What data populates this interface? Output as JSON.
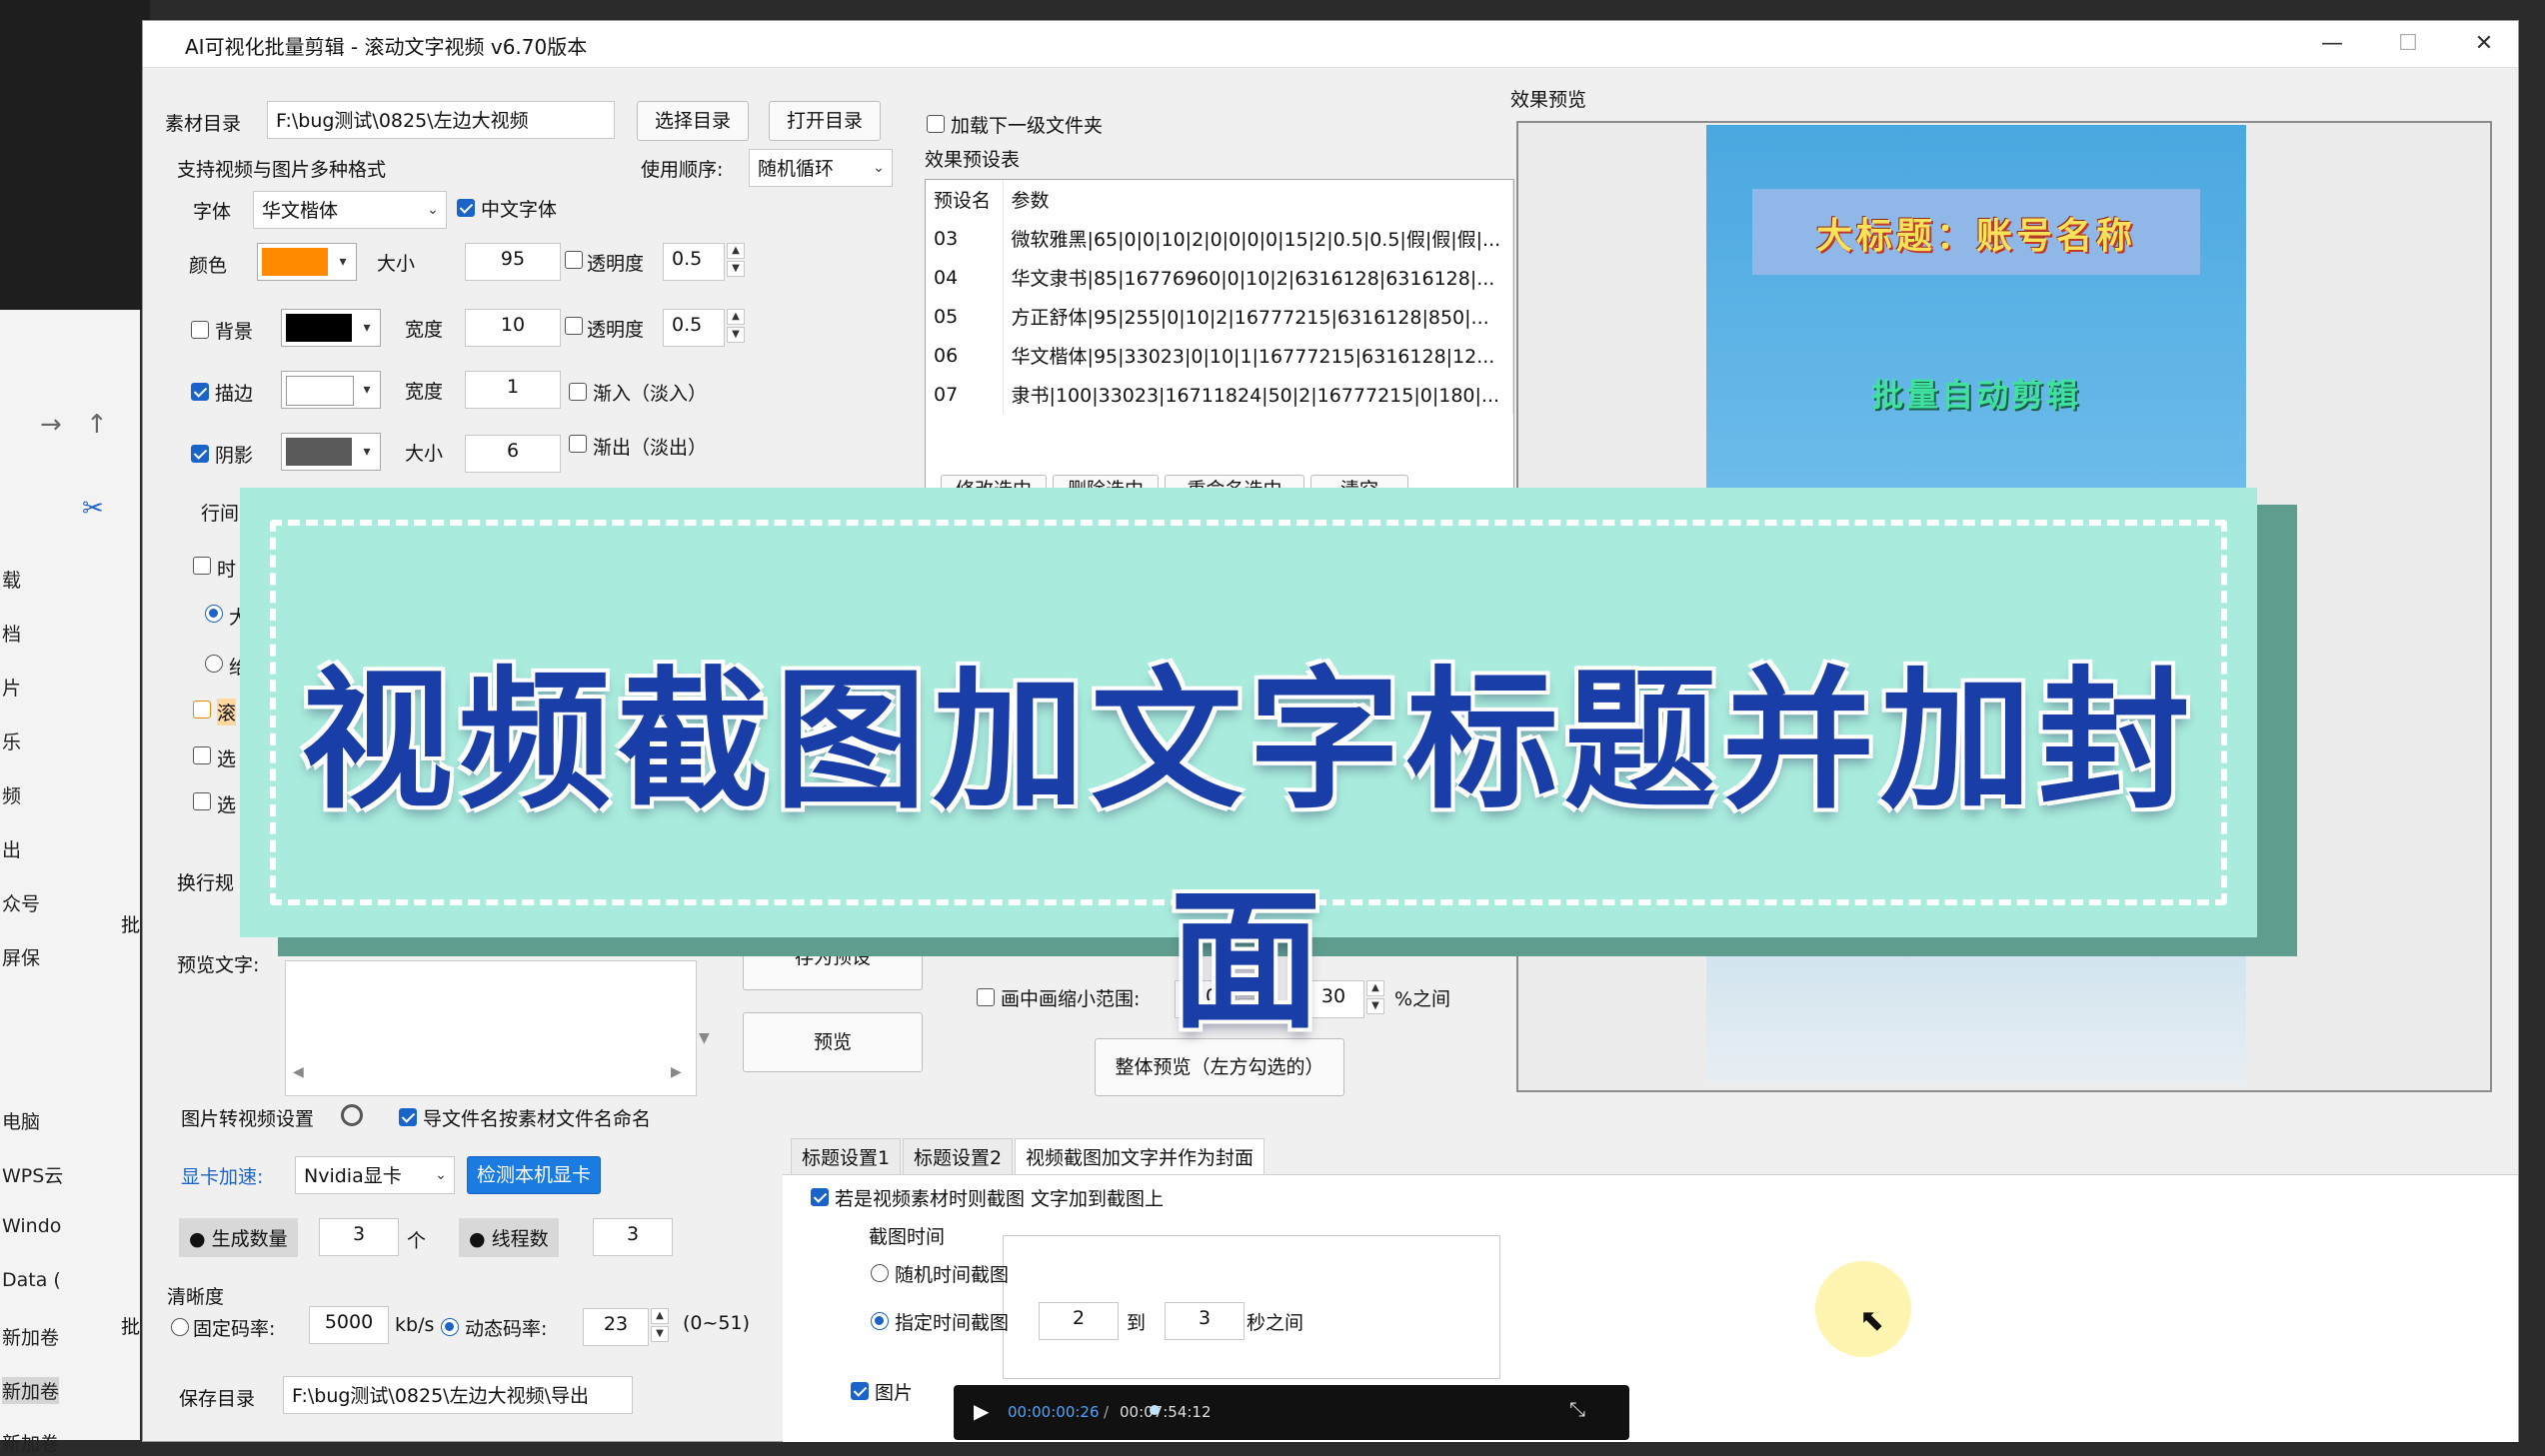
{
  "window": {
    "title": "AI可视化批量剪辑 - 滚动文字视频  v6.70版本",
    "min_icon": "—",
    "max_icon": "☐",
    "close_icon": "✕"
  },
  "explorer": {
    "items": [
      "载",
      "档",
      "片",
      "乐",
      "频",
      "出",
      "众号",
      "屏保",
      "电脑",
      "WPS云",
      "Windo",
      "Data (",
      "新加卷",
      "新加卷",
      "新加卷"
    ],
    "batch_labels": [
      "批",
      "批"
    ]
  },
  "material": {
    "label": "素材目录",
    "path": "F:\\bug测试\\0825\\左边大视频",
    "choose_btn": "选择目录",
    "open_btn": "打开目录",
    "formats_note": "支持视频与图片多种格式",
    "order_label": "使用顺序:",
    "order_value": "随机循环",
    "load_sub_label": "加载下一级文件夹"
  },
  "font": {
    "label": "字体",
    "value": "华文楷体",
    "chinese_font_label": "中文字体",
    "color_label": "颜色",
    "color_value": "#ff8a00",
    "size_label": "大小",
    "size_value": "95",
    "opacity_label": "透明度",
    "opacity_value": "0.5"
  },
  "background": {
    "label": "背景",
    "color_value": "#000000",
    "width_label": "宽度",
    "width_value": "10",
    "opacity_label": "透明度",
    "opacity_value": "0.5"
  },
  "stroke": {
    "label": "描边",
    "color_value": "#ffffff",
    "width_label": "宽度",
    "width_value": "1",
    "fade_in_label": "渐入（淡入）"
  },
  "shadow": {
    "label": "阴影",
    "color_value": "#5a5a5a",
    "size_label": "大小",
    "size_value": "6",
    "fade_out_label": "渐出（淡出）"
  },
  "partial_labels": {
    "line_spacing": "行间",
    "time": "时",
    "big": "大",
    "small": "绐",
    "scroll": "滚",
    "select1": "选",
    "select2": "选",
    "wrap": "换行规",
    "preview_text": "预览文字:"
  },
  "presets": {
    "section_label": "效果预设表",
    "col_name": "预设名",
    "col_params": "参数",
    "rows": [
      {
        "name": "03",
        "params": "微软雅黑|65|0|0|10|2|0|0|0|0|15|2|0.5|0.5|假|假|假|..."
      },
      {
        "name": "04",
        "params": "华文隶书|85|16776960|0|10|2|6316128|6316128|..."
      },
      {
        "name": "05",
        "params": "方正舒体|95|255|0|10|2|16777215|6316128|850|..."
      },
      {
        "name": "06",
        "params": "华文楷体|95|33023|0|10|1|16777215|6316128|12..."
      },
      {
        "name": "07",
        "params": "隶书|100|33023|16711824|50|2|16777215|0|180|..."
      }
    ],
    "buttons": [
      "修改选中",
      "删除选中",
      "重命名选中",
      "清空"
    ],
    "save_btn": "存为预设",
    "preview_btn": "预览"
  },
  "pip": {
    "label": "画中画缩小范围:",
    "from": "10",
    "dash": "-",
    "to": "30",
    "unit": "%之间"
  },
  "overall_preview_btn": "整体预览（左方勾选的）",
  "preview_panel": {
    "label": "效果预览",
    "title_text": "大标题：账号名称",
    "sub_text": "批量自动剪辑"
  },
  "banner": {
    "text": "视频截图加文字标题并加封面"
  },
  "img2video": {
    "label": "图片转视频设置",
    "export_name_label": "导文件名按素材文件名命名",
    "gpu_label": "显卡加速:",
    "gpu_value": "Nvidia显卡",
    "detect_btn": "检测本机显卡",
    "count_label": "生成数量",
    "count_value": "3",
    "count_unit": "个",
    "threads_label": "线程数",
    "threads_value": "3"
  },
  "quality": {
    "label": "清晰度",
    "fixed_label": "固定码率:",
    "fixed_value": "5000",
    "fixed_unit": "kb/s",
    "dynamic_label": "动态码率:",
    "dynamic_value": "23",
    "range_note": "(0~51)"
  },
  "save_dir": {
    "label": "保存目录",
    "path": "F:\\bug测试\\0825\\左边大视频\\导出"
  },
  "tabs": {
    "items": [
      "标题设置1",
      "标题设置2",
      "视频截图加文字并作为封面"
    ],
    "screenshot_check_label": "若是视频素材时则截图 文字加到截图上",
    "group_label": "截图时间",
    "random_label": "随机时间截图",
    "specified_label": "指定时间截图",
    "from_value": "2",
    "to_label": "到",
    "to_value": "3",
    "sec_label": "秒之间",
    "image_check_label": "图片"
  },
  "player": {
    "current_time": "00:00:00:26",
    "separator": "/",
    "total_time": "00:07:54:12"
  }
}
